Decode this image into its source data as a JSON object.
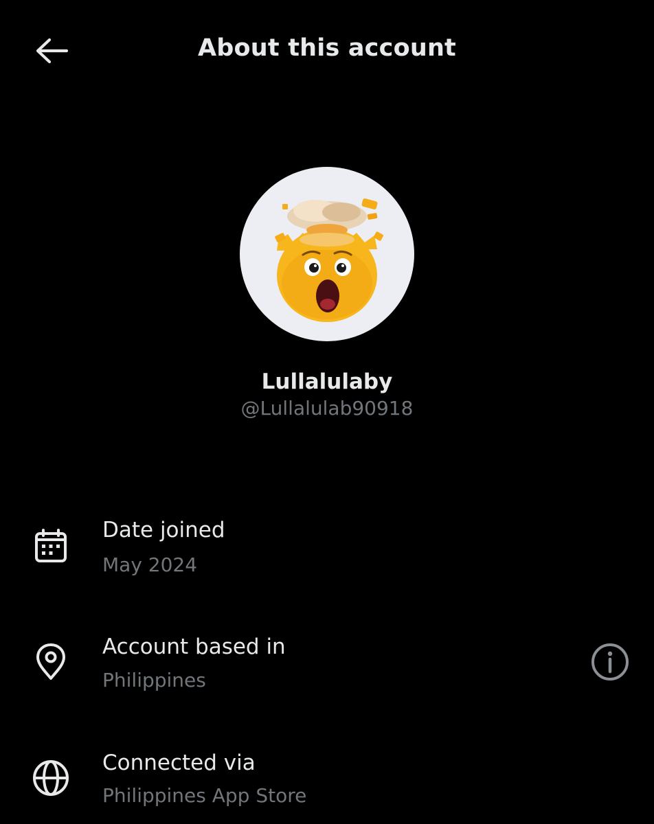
{
  "header": {
    "back_icon": "arrow-left-icon",
    "title": "About this account"
  },
  "profile": {
    "avatar_icon": "exploding-head-emoji",
    "display_name": "Lullalulaby",
    "handle": "@Lullalulab90918"
  },
  "details": [
    {
      "icon": "calendar-icon",
      "label": "Date joined",
      "value": "May 2024"
    },
    {
      "icon": "location-pin-icon",
      "label": "Account based in",
      "value": "Philippines"
    },
    {
      "icon": "globe-icon",
      "label": "Connected via",
      "value": "Philippines App Store"
    }
  ],
  "info_icon": "info-circle-icon",
  "colors": {
    "background": "#000000",
    "primary_text": "#e7e9ea",
    "secondary_text": "#71767b",
    "avatar_bg": "#eceef3"
  }
}
